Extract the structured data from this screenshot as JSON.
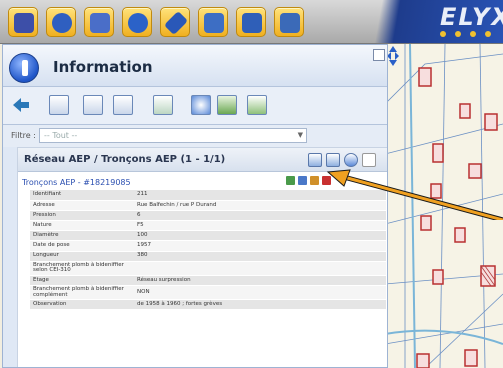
{
  "app": {
    "logo_text": "ELYX",
    "toolbar_icons": [
      {
        "icon": "select-tool-icon",
        "color": "#3d4fa8"
      },
      {
        "icon": "identify-tool-icon",
        "color": "#2f5fc0"
      },
      {
        "icon": "layers-tool-icon",
        "color": "#4a6ec8"
      },
      {
        "icon": "globe-tool-icon",
        "color": "#2b62c8"
      },
      {
        "icon": "draw-tool-icon",
        "color": "#2a58b8"
      },
      {
        "icon": "measure-tool-icon",
        "color": "#3d6ec4"
      },
      {
        "icon": "edit-tool-icon",
        "color": "#2f5fb8"
      },
      {
        "icon": "print-tool-icon",
        "color": "#3b6ab8"
      }
    ]
  },
  "panel": {
    "title": "Information",
    "filter_label": "Filtre :",
    "filter_value": "-- Tout --",
    "section_title": "Réseau AEP / Tronçons AEP (1 - 1/1)",
    "record_link": "Tronçons AEP - #18219085",
    "attributes": [
      {
        "key": "Identifiant",
        "value": "211"
      },
      {
        "key": "Adresse",
        "value": "Rue Balfechin / rue P Durand"
      },
      {
        "key": "Pression",
        "value": "6"
      },
      {
        "key": "Nature",
        "value": "F5"
      },
      {
        "key": "Diamètre",
        "value": "100"
      },
      {
        "key": "Date de pose",
        "value": "1957"
      },
      {
        "key": "Longueur",
        "value": "380"
      },
      {
        "key": "Branchement plomb à bideniffier selon CEI-310",
        "value": ""
      },
      {
        "key": "Etage",
        "value": "Réseau surpression"
      },
      {
        "key": "Branchement plomb à bideniffier complément",
        "value": "NON"
      },
      {
        "key": "Observation",
        "value": "de 1958 à 1960 ; fortes grèves"
      }
    ]
  },
  "colors": {
    "accent_orange": "#f0a020",
    "panel_blue": "#dfe8f5",
    "link_blue": "#2b4fb0",
    "logo_blue": "#1e3c8c"
  }
}
